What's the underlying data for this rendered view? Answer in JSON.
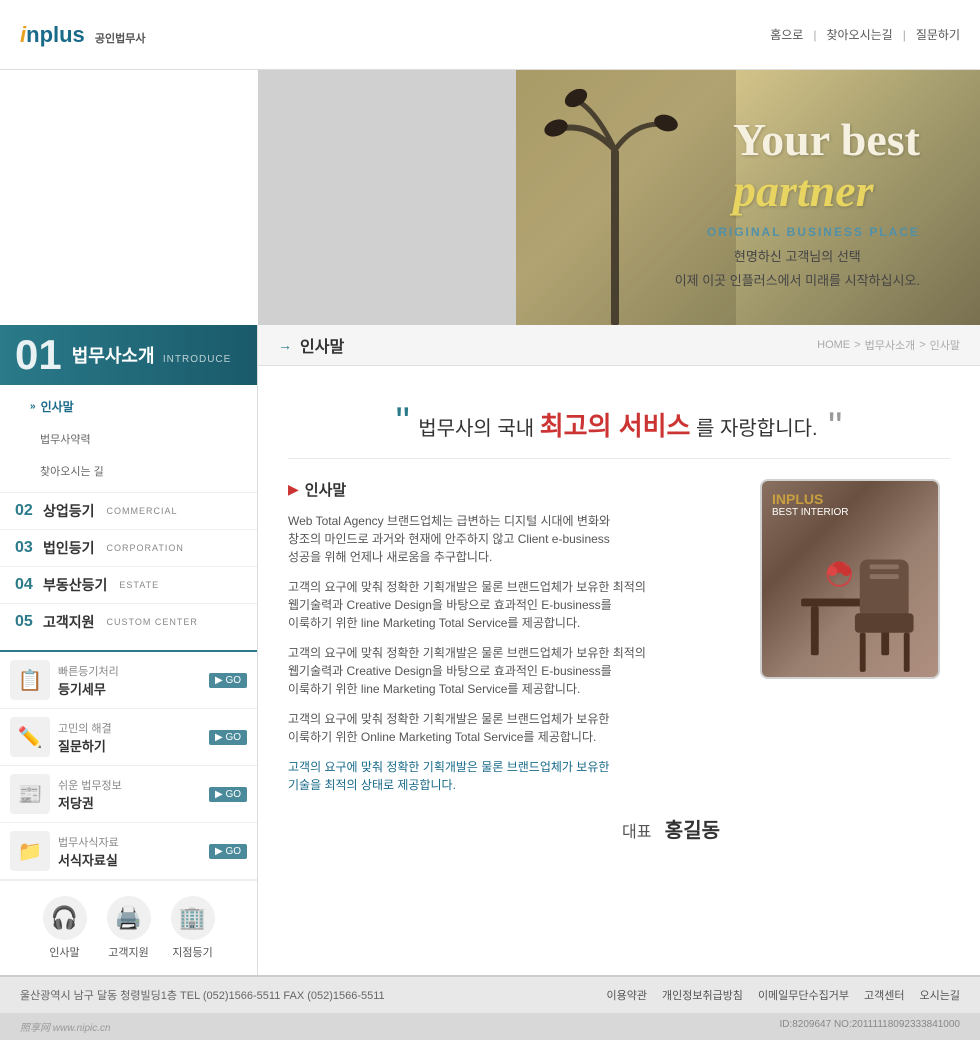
{
  "header": {
    "logo_i": "i",
    "logo_rest": "nplus",
    "logo_subtitle": "공인법무사",
    "nav": {
      "home": "홈으로",
      "directions": "찾아오시는길",
      "contact": "질문하기"
    }
  },
  "banner": {
    "line1": "Your best",
    "line2": "partner",
    "subtitle": "ORIGINAL BUSINESS PLACE",
    "desc_line1": "현명하신 고객님의 선택",
    "desc_line2": "이제 이곳 인플러스에서 미래를 시작하십시오."
  },
  "sidebar": {
    "section_num": "01",
    "section_title_kr": "법무사소개",
    "section_title_en": "INTRODUCE",
    "menu_items": [
      {
        "label": "인사말",
        "prefix": ">>>",
        "active": true
      },
      {
        "label": "법무사약력",
        "sub": true
      },
      {
        "label": "찾아오시는 길",
        "sub": true
      }
    ],
    "categories": [
      {
        "num": "02",
        "kr": "상업등기",
        "en": "COMMERCIAL"
      },
      {
        "num": "03",
        "kr": "법인등기",
        "en": "CORPORATION"
      },
      {
        "num": "04",
        "kr": "부동산등기",
        "en": "ESTATE"
      },
      {
        "num": "05",
        "kr": "고객지원",
        "en": "CUSTOM CENTER"
      }
    ],
    "quick_links": [
      {
        "title": "빠른등기처리",
        "name": "등기세무",
        "icon": "📋"
      },
      {
        "title": "고민의 해결",
        "name": "질문하기",
        "icon": "✏️"
      },
      {
        "title": "쉬운 법무정보",
        "name": "저당권",
        "icon": "📰"
      },
      {
        "title": "법무사식자료",
        "name": "서식자료실",
        "icon": "📁"
      }
    ],
    "go_label": "GO",
    "icon_links": [
      {
        "label": "인사말",
        "icon": "🎧"
      },
      {
        "label": "고객지원",
        "icon": "🖨️"
      },
      {
        "label": "지점등기",
        "icon": "🏢"
      }
    ]
  },
  "breadcrumb": {
    "home": "HOME",
    "parent": "법무사소개",
    "current": "인사말",
    "separator": ">"
  },
  "page_title": "인사말",
  "quote": {
    "left_mark": "“",
    "right_mark": "”",
    "prefix": "법무사의 국내 ",
    "highlight": "최고의 서비스",
    "suffix": "를 자랑합니다."
  },
  "content": {
    "section_title": "인사말",
    "paragraphs": [
      "Web Total Agency 브랜드업체는 급변하는 디지털 시대에 변화와\n창조의 마인드로 과거와 현재에 안주하지 않고 Client e-business\n성공을 위해 언제나 새로움을 추구합니다.",
      "고객의 요구에 맞춰 정확한 기획개발은 물론 브랜드업체가 보유한 최적의\n웹기술력과 Creative Design을 바탕으로 효과적인 E-business를\n이룩하기 위한 line Marketing Total Service를 제공합니다.",
      "고객의 요구에 맞춰 정확한 기획개발은 물론 브랜드업체가 보유한 최적의\n웹기술력과 Creative Design을 바탕으로 효과적인 E-business를\n이룩하기 위한 line Marketing Total Service를 제공합니다.",
      "고객의 요구에 맞춰 정확한 기획개발은 물론 브랜드업체가 보유한\n이룩하기 위한 Online Marketing Total Service를 제공합니다."
    ],
    "link_text": "고객의 요구에 맞춰 정확한 기획개발은 물론 브랜드업체가 보유한\n기술을 최적의 상태로 제공합니다.",
    "signature_title": "대표",
    "signature_name": "홍길동",
    "image_brand": "INPLUS",
    "image_subtitle": "BEST INTERIOR"
  },
  "footer": {
    "address": "울산광역시 남구 달동 청령빌딩1층  TEL (052)1566-5511  FAX (052)1566-5511",
    "links": [
      "이용약관",
      "개인정보취급방침",
      "이메일무단수집거부",
      "고객센터",
      "오시는길"
    ],
    "watermark": "照享网 www.nipic.cn",
    "copyright": "ID:8209647 NO:20111118092333841000"
  }
}
